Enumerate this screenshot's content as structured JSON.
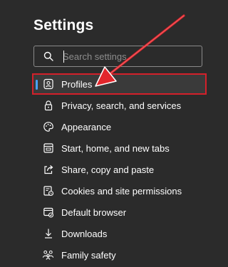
{
  "header": {
    "title": "Settings"
  },
  "search": {
    "placeholder": "Search settings",
    "value": ""
  },
  "sidebar": {
    "items": [
      {
        "label": "Profiles",
        "icon": "profile-icon",
        "active": true
      },
      {
        "label": "Privacy, search, and services",
        "icon": "lock-icon"
      },
      {
        "label": "Appearance",
        "icon": "palette-icon"
      },
      {
        "label": "Start, home, and new tabs",
        "icon": "start-page-icon"
      },
      {
        "label": "Share, copy and paste",
        "icon": "share-icon"
      },
      {
        "label": "Cookies and site permissions",
        "icon": "cookies-icon"
      },
      {
        "label": "Default browser",
        "icon": "default-browser-icon"
      },
      {
        "label": "Downloads",
        "icon": "download-icon"
      },
      {
        "label": "Family safety",
        "icon": "family-icon"
      }
    ]
  },
  "colors": {
    "background": "#2b2b2b",
    "highlight_border": "#d4202a",
    "annotation_arrow": "#e2262c",
    "accent": "#4aa3ff"
  }
}
